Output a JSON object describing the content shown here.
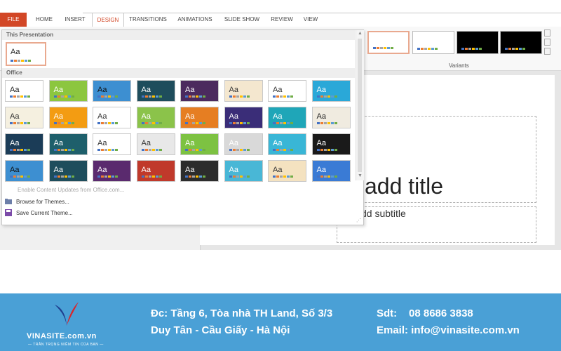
{
  "ribbon": {
    "tabs": [
      {
        "label": "FILE"
      },
      {
        "label": "HOME"
      },
      {
        "label": "INSERT"
      },
      {
        "label": "DESIGN"
      },
      {
        "label": "TRANSITIONS"
      },
      {
        "label": "ANIMATIONS"
      },
      {
        "label": "SLIDE SHOW"
      },
      {
        "label": "REVIEW"
      },
      {
        "label": "VIEW"
      }
    ],
    "active_tab": "DESIGN",
    "variants_label": "Variants",
    "accent_color": "#d24726"
  },
  "gallery": {
    "this_presentation_label": "This Presentation",
    "office_label": "Office",
    "theme_sample_text": "Aa",
    "menu": {
      "enable_updates": "Enable Content Updates from Office.com...",
      "browse": "Browse for Themes...",
      "save": "Save Current Theme..."
    }
  },
  "slide": {
    "title_placeholder": "add title",
    "subtitle_placeholder": "dd subtitle"
  },
  "footer": {
    "brand": "VINASITE.com.vn",
    "tagline": "— TRÂN TRỌNG NIỀM TIN CỦA BẠN —",
    "address_line1": "Đc: Tầng 6, Tòa nhà TH Land, Số 3/3",
    "address_line2": "Duy Tân - Cầu Giấy - Hà Nội",
    "phone_label": "Sdt:",
    "phone": "08 8686 3838",
    "email_line": "Email: info@vinasite.com.vn",
    "background_color": "#4aa0d6"
  }
}
